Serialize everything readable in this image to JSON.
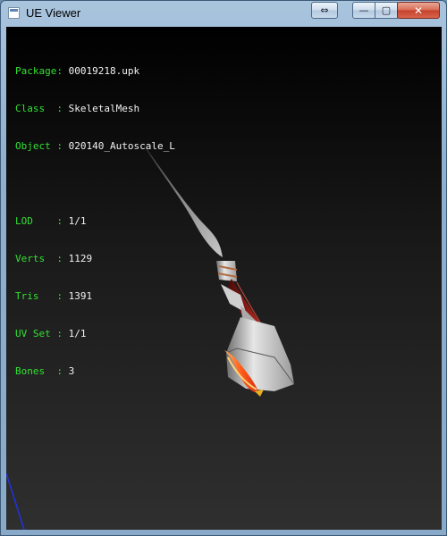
{
  "window": {
    "title": "UE Viewer",
    "controls": {
      "swap": "⇔",
      "minimize": "—",
      "maximize": "▢",
      "close": "✕"
    }
  },
  "info": {
    "package": {
      "label": "Package: ",
      "value": "00019218.upk"
    },
    "class": {
      "label": "Class  : ",
      "value": "SkeletalMesh"
    },
    "object": {
      "label": "Object : ",
      "value": "020140_Autoscale_L"
    },
    "lod": {
      "label": "LOD    : ",
      "value": "1/1"
    },
    "verts": {
      "label": "Verts  : ",
      "value": "1129"
    },
    "tris": {
      "label": "Tris   : ",
      "value": "1391"
    },
    "uvset": {
      "label": "UV Set : ",
      "value": "1/1"
    },
    "bones": {
      "label": "Bones  : ",
      "value": "3"
    }
  },
  "colors": {
    "label_green": "#33e033",
    "value_white": "#f2f2f2",
    "viewport_bg": "#1a1a1a",
    "axis_blue": "#2233dd"
  }
}
